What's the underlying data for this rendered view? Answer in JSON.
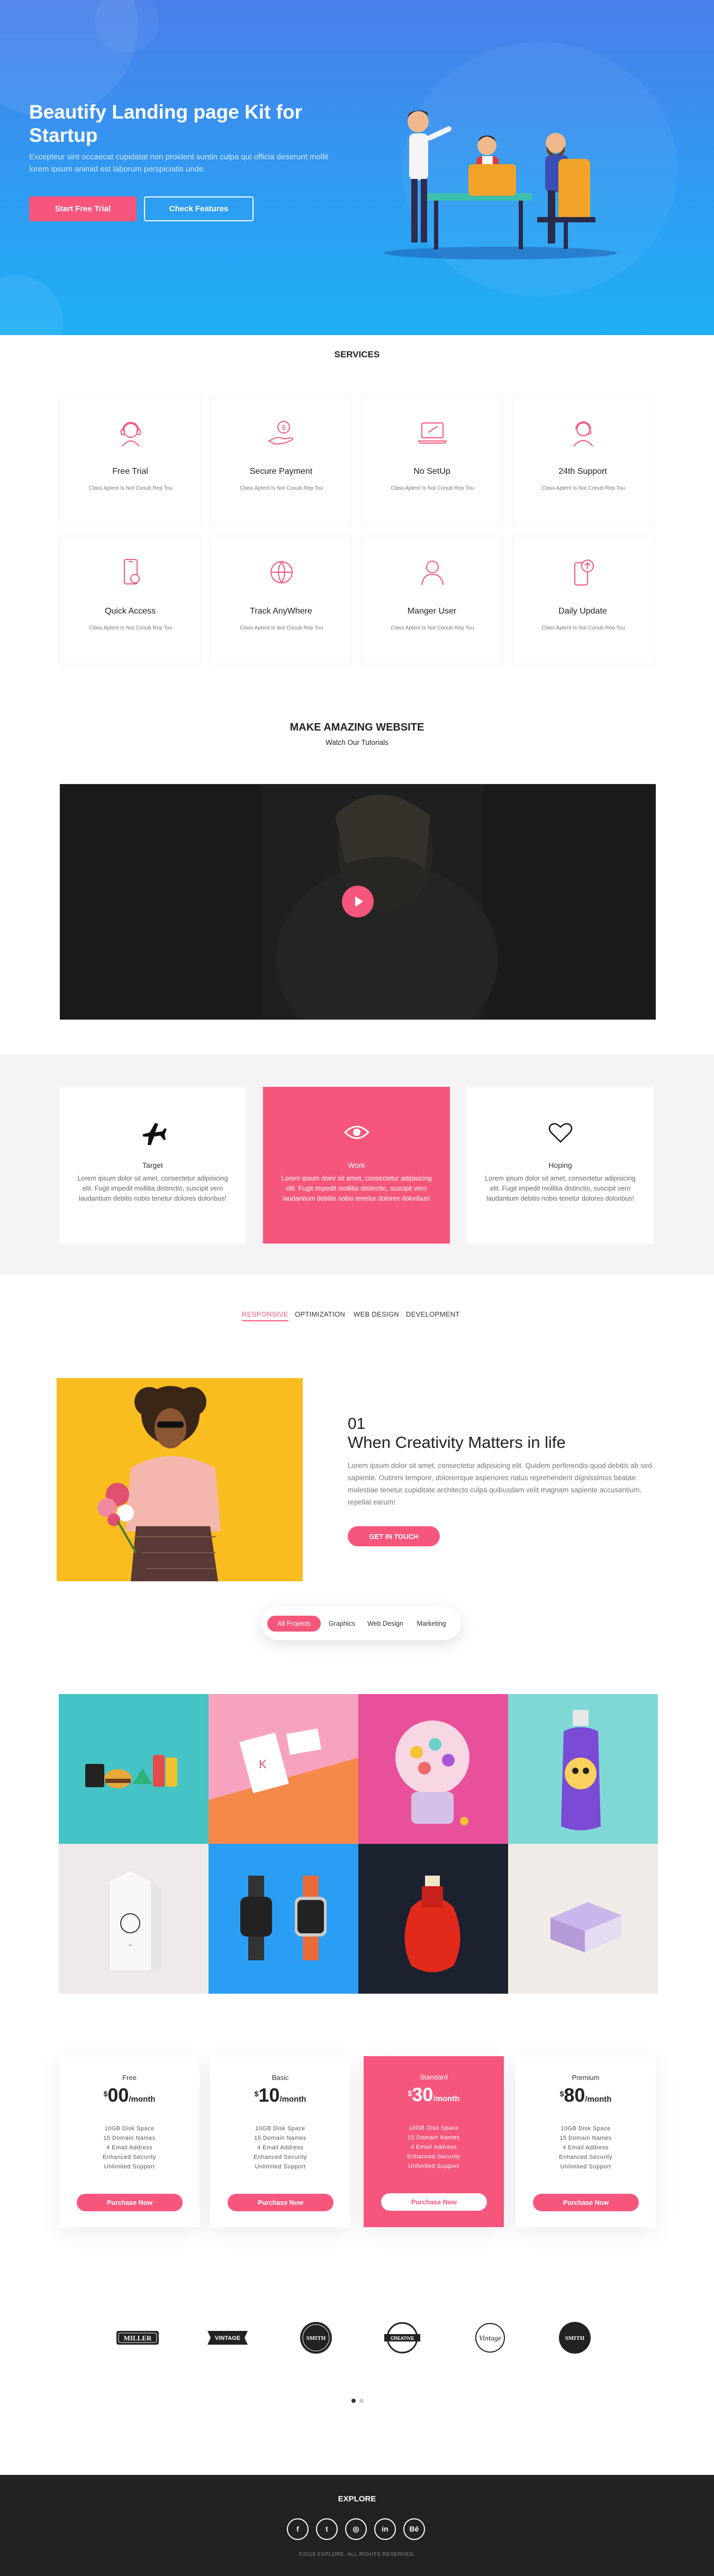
{
  "colors": {
    "accent": "#f7567c",
    "hero_top": "#4a7eea",
    "hero_bottom": "#1fb0f6",
    "footer": "#222222",
    "band": "#f5f3f5"
  },
  "hero": {
    "title": "Beautify Landing page Kit for Startup",
    "text": "Excepteur sint occaecat cupidatat non proident suntin culpa qui officia deserunt mollit lorem ipsum animid est laborum perspiciatis unde.",
    "primary_button": "Start Free Trial",
    "secondary_button": "Check Features"
  },
  "services": {
    "title": "SERVICES",
    "items": [
      {
        "title": "Free Trial",
        "desc": "Class Aptent Is Not Conub Rep Tou",
        "icon": "headset-icon"
      },
      {
        "title": "Secure Payment",
        "desc": "Class Aptent Is Not Conub Rep Tou",
        "icon": "payment-hand-icon"
      },
      {
        "title": "No SetUp",
        "desc": "Class Aptent Is Not Conub Rep Tou",
        "icon": "laptop-setup-icon"
      },
      {
        "title": "24th Support",
        "desc": "Class Aptent Is Not Conub Rep Tou",
        "icon": "support-agent-icon"
      },
      {
        "title": "Quick Access",
        "desc": "Class Aptent Is Not Conub Rep Tou",
        "icon": "mobile-access-icon"
      },
      {
        "title": "Track AnyWhere",
        "desc": "Class Aptent Is Not Conub Rep Tou",
        "icon": "globe-track-icon"
      },
      {
        "title": "Manger User",
        "desc": "Class Aptent Is Not Conub Rep Tou",
        "icon": "user-manager-icon"
      },
      {
        "title": "Daily Update",
        "desc": "Class Aptent Is Not Conub Rep Tou",
        "icon": "phone-update-icon"
      }
    ]
  },
  "video": {
    "title": "MAKE AMAZING WEBSITE",
    "subtitle": "Watch Our Tutorials"
  },
  "features": [
    {
      "title": "Target",
      "text": "Lorem ipsum dolor sit amet, consectetur adipisicing elit. Fugit impedit mollitia distinctio, suscipit vero laudantium debitis nobis tenetur dolores doloribus!",
      "icon": "airplane-icon"
    },
    {
      "title": "Work",
      "text": "Lorem ipsum dolor sit amet, consectetur adipisicing elit. Fugit impedit mollitia distinctio, suscipit vero laudantium debitis nobis tenetur dolores doloribus!",
      "icon": "eye-icon"
    },
    {
      "title": "Hoping",
      "text": "Lorem ipsum dolor sit amet, consectetur adipisicing elit. Fugit impedit mollitia distinctio, suscipit vero laudantium debitis nobis tenetur dolores doloribus!",
      "icon": "heart-icon"
    }
  ],
  "tabs": [
    "RESPONSIVE",
    "OPTIMIZATION",
    "WEB DESIGN",
    "DEVELOPMENT"
  ],
  "creativity": {
    "number": "01",
    "title": "When Creativity Matters in life",
    "text": "Lorem ipsum dolor sit amet, consectetur adipisicing elit. Quidem perferendis quod debitis ab sed sapiente. Outinmi tempore, doloremque asperiores natus reprehenderit dignissimos beatae molestiae tenetur cupiditate architecto culpa quibusdam velit magnam sapiente accusantium, repellat earum!",
    "button": "GET IN TOUCH"
  },
  "filters": [
    "All Projects",
    "Graphics",
    "Web Design",
    "Marketing"
  ],
  "pricing": [
    {
      "name": "Free",
      "currency": "$",
      "price": "00",
      "period": "/month",
      "features": [
        "10GB Disk Space",
        "15 Domain Names",
        "4 Email Address",
        "Enhanced Security",
        "Unlimited Support"
      ],
      "button": "Purchase Now"
    },
    {
      "name": "Basic",
      "currency": "$",
      "price": "10",
      "period": "/month",
      "features": [
        "10GB Disk Space",
        "15 Domain Names",
        "4 Email Address",
        "Enhanced Security",
        "Unlimited Support"
      ],
      "button": "Purchase Now"
    },
    {
      "name": "Standard",
      "currency": "$",
      "price": "30",
      "period": "/month",
      "features": [
        "10GB Disk Space",
        "15 Domain Names",
        "4 Email Address",
        "Enhanced Security",
        "Unlimited Support"
      ],
      "button": "Purchase Now"
    },
    {
      "name": "Premium",
      "currency": "$",
      "price": "80",
      "period": "/month",
      "features": [
        "10GB Disk Space",
        "15 Domain Names",
        "4 Email Address",
        "Enhanced Security",
        "Unlimited Support"
      ],
      "button": "Purchase Now"
    }
  ],
  "logos": [
    "MILLER",
    "VINTAGE",
    "SMITH",
    "CREATIVE",
    "Vintage",
    "SMITH"
  ],
  "footer": {
    "title": "EXPLORE",
    "social": [
      {
        "icon": "facebook-icon",
        "glyph": "f"
      },
      {
        "icon": "twitter-icon",
        "glyph": "t"
      },
      {
        "icon": "instagram-icon",
        "glyph": "◎"
      },
      {
        "icon": "linkedin-icon",
        "glyph": "in"
      },
      {
        "icon": "behance-icon",
        "glyph": "Bē"
      }
    ],
    "copyright": "©2019 EXPLORE. ALL RIGHTS RESERVED."
  }
}
